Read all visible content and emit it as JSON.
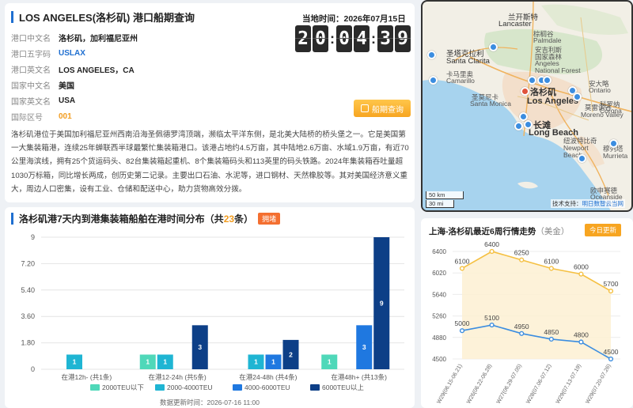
{
  "port": {
    "title": "LOS ANGELES(洛杉矶) 港口船期查询",
    "time_label": "当地时间：2026年07月15日",
    "clock_digits": [
      "2",
      "0",
      "0",
      "4",
      "3",
      "9"
    ],
    "fields": [
      {
        "key": "港口中文名",
        "value": "洛杉矶，加利福尼亚州",
        "style": "normal"
      },
      {
        "key": "港口五字码",
        "value": "USLAX",
        "style": "blue"
      },
      {
        "key": "港口英文名",
        "value": "LOS ANGELES，CA",
        "style": "normal"
      },
      {
        "key": "国家中文名",
        "value": "美国",
        "style": "normal"
      },
      {
        "key": "国家英文名",
        "value": "USA",
        "style": "normal"
      },
      {
        "key": "国际区号",
        "value": "001",
        "style": "orange"
      }
    ],
    "schedule_button": "船期查询",
    "description": "洛杉矶港位于美国加利福尼亚州西南沿海圣佩德罗湾顶端，濒临太平洋东侧，是北美大陆桥的桥头堡之一。它是美国第一大集装箱港，连续25年蝉联西半球最繁忙集装箱港口。该港占地约4.5万亩，其中陆地2.6万亩、水域1.9万亩，有近70公里海滨线，拥有25个货运码头、82台集装箱起重机、8个集装箱码头和113英里的码头铁路。2024年集装箱吞吐量超1030万标箱，同比增长两成，创历史第二记录。主要出口石油、水泥等，进口钢材、天然橡胶等。其对美国经济意义重大，周边人口密集，设有工业、仓储和配送中心，助力货物高效分拨。"
  },
  "map": {
    "labels": [
      {
        "text": "兰开斯特",
        "size": "med"
      },
      {
        "text": "Lancaster",
        "size": "med"
      },
      {
        "text": "棕榈谷",
        "size": "small"
      },
      {
        "text": "Palmdale",
        "size": "small"
      },
      {
        "text": "安吉利斯",
        "size": "small"
      },
      {
        "text": "国家森林",
        "size": "small"
      },
      {
        "text": "Angeles",
        "size": "small"
      },
      {
        "text": "National Forest",
        "size": "small"
      },
      {
        "text": "圣塔克拉利",
        "size": "med"
      },
      {
        "text": "Santa Clarita",
        "size": "med"
      },
      {
        "text": "卡马里奥",
        "size": "small"
      },
      {
        "text": "Camarillo",
        "size": "small"
      },
      {
        "text": "洛杉矶",
        "size": "big"
      },
      {
        "text": "Los Angeles",
        "size": "big"
      },
      {
        "text": "圣莫尼卡",
        "size": "small"
      },
      {
        "text": "Santa Monica",
        "size": "small"
      },
      {
        "text": "长滩",
        "size": "big"
      },
      {
        "text": "Long Beach",
        "size": "big"
      },
      {
        "text": "安大略",
        "size": "small"
      },
      {
        "text": "Ontario",
        "size": "small"
      },
      {
        "text": "科罗纳",
        "size": "small"
      },
      {
        "text": "Corona",
        "size": "small"
      },
      {
        "text": "莫雷诺谷",
        "size": "small"
      },
      {
        "text": "Moreno Valley",
        "size": "small"
      },
      {
        "text": "纽波特比奇",
        "size": "small"
      },
      {
        "text": "Newport",
        "size": "small"
      },
      {
        "text": "Beach",
        "size": "small"
      },
      {
        "text": "穆列塔",
        "size": "small"
      },
      {
        "text": "Murrieta",
        "size": "small"
      },
      {
        "text": "欧申赛德",
        "size": "small"
      },
      {
        "text": "Oceanside",
        "size": "small"
      }
    ],
    "scale_km": "50 km",
    "scale_mi": "30 mi",
    "attribution_prefix": "技术支持：",
    "attribution_link": "明日数智云当网"
  },
  "bar_chart": {
    "title_prefix": "洛杉矶港7天内到港集装箱船舶在港时间分布（共",
    "title_count": "23",
    "title_suffix": "条）",
    "badge": "拥堵",
    "updated": "数据更新时间：2026-07-16 11:00",
    "chart_data": {
      "type": "bar",
      "categories": [
        "在港12h- (共1条)",
        "在港12-24h (共5条)",
        "在港24-48h (共4条)",
        "在港48h+ (共13条)"
      ],
      "series": [
        {
          "name": "2000TEU以下",
          "color": "#4fd8b9",
          "values": [
            0,
            1,
            0,
            1
          ]
        },
        {
          "name": "2000-4000TEU",
          "color": "#1fb5d3",
          "values": [
            1,
            1,
            1,
            0
          ]
        },
        {
          "name": "4000-6000TEU",
          "color": "#1f78e0",
          "values": [
            0,
            0,
            1,
            3
          ]
        },
        {
          "name": "6000TEU以上",
          "color": "#0d3f87",
          "values": [
            0,
            3,
            2,
            9
          ]
        }
      ],
      "yticks": [
        "0",
        "1.80",
        "3.60",
        "5.40",
        "7.20",
        "9"
      ],
      "ylim": [
        0,
        9
      ],
      "legend": "bottom"
    }
  },
  "line_chart": {
    "title": "上海-洛杉矶最近6周行情走势",
    "unit": "（美金）",
    "today_button": "今日更新",
    "chart_data": {
      "type": "line",
      "categories": [
        "W29(06.15-06.21)",
        "W26(06.22-06.28)",
        "W27(06.29-07.05)",
        "W28(07.06-07.12)",
        "W29(07.13-07.19)",
        "W29(07.20-07.26)"
      ],
      "series": [
        {
          "name": "",
          "color": "#f5c042",
          "values": [
            6100,
            6400,
            6250,
            6100,
            6000,
            5700
          ]
        },
        {
          "name": "",
          "color": "#3b8de0",
          "values": [
            5000,
            5100,
            4950,
            4850,
            4800,
            4500
          ]
        }
      ],
      "yticks": [
        "4500",
        "4880",
        "5260",
        "5640",
        "6020",
        "6400"
      ],
      "ylim": [
        4500,
        6400
      ]
    }
  }
}
